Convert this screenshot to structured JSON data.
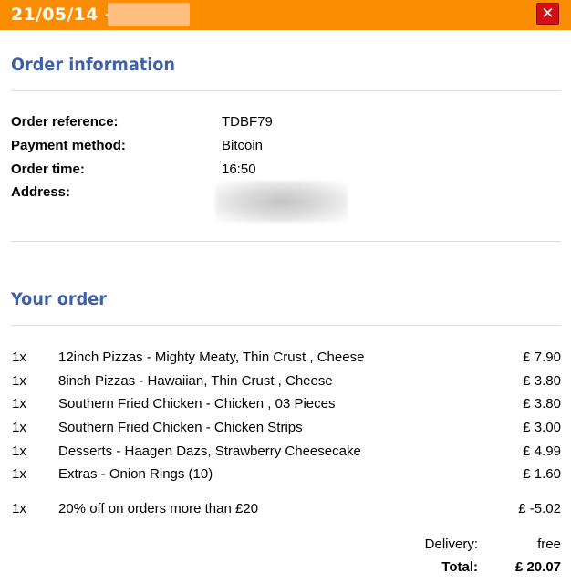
{
  "window": {
    "title": "21/05/14 -",
    "close_glyph": "✕",
    "accent_color": "#fa8c00",
    "heading_color": "#3d60a8",
    "close_color": "#d40f14"
  },
  "order_information": {
    "heading": "Order information",
    "fields": [
      {
        "label": "Order reference:",
        "value": "TDBF79"
      },
      {
        "label": "Payment method:",
        "value": "Bitcoin"
      },
      {
        "label": "Order time:",
        "value": "16:50"
      },
      {
        "label": "Address:",
        "value": ""
      }
    ]
  },
  "your_order": {
    "heading": "Your order",
    "items": [
      {
        "qty": "1x",
        "description": "12inch Pizzas - Mighty Meaty, Thin Crust , Cheese",
        "price": "£ 7.90"
      },
      {
        "qty": "1x",
        "description": "8inch Pizzas - Hawaiian, Thin Crust , Cheese",
        "price": "£ 3.80"
      },
      {
        "qty": "1x",
        "description": "Southern Fried Chicken - Chicken , 03 Pieces",
        "price": "£ 3.80"
      },
      {
        "qty": "1x",
        "description": "Southern Fried Chicken - Chicken Strips",
        "price": "£ 3.00"
      },
      {
        "qty": "1x",
        "description": "Desserts - Haagen Dazs, Strawberry Cheesecake",
        "price": "£ 4.99"
      },
      {
        "qty": "1x",
        "description": "Extras - Onion Rings (10)",
        "price": "£ 1.60"
      }
    ],
    "discount": {
      "qty": "1x",
      "description": "20% off on orders more than £20",
      "price": "£ -5.02"
    },
    "delivery_label": "Delivery:",
    "delivery_value": "free",
    "total_label": "Total:",
    "total_value": "£ 20.07"
  }
}
